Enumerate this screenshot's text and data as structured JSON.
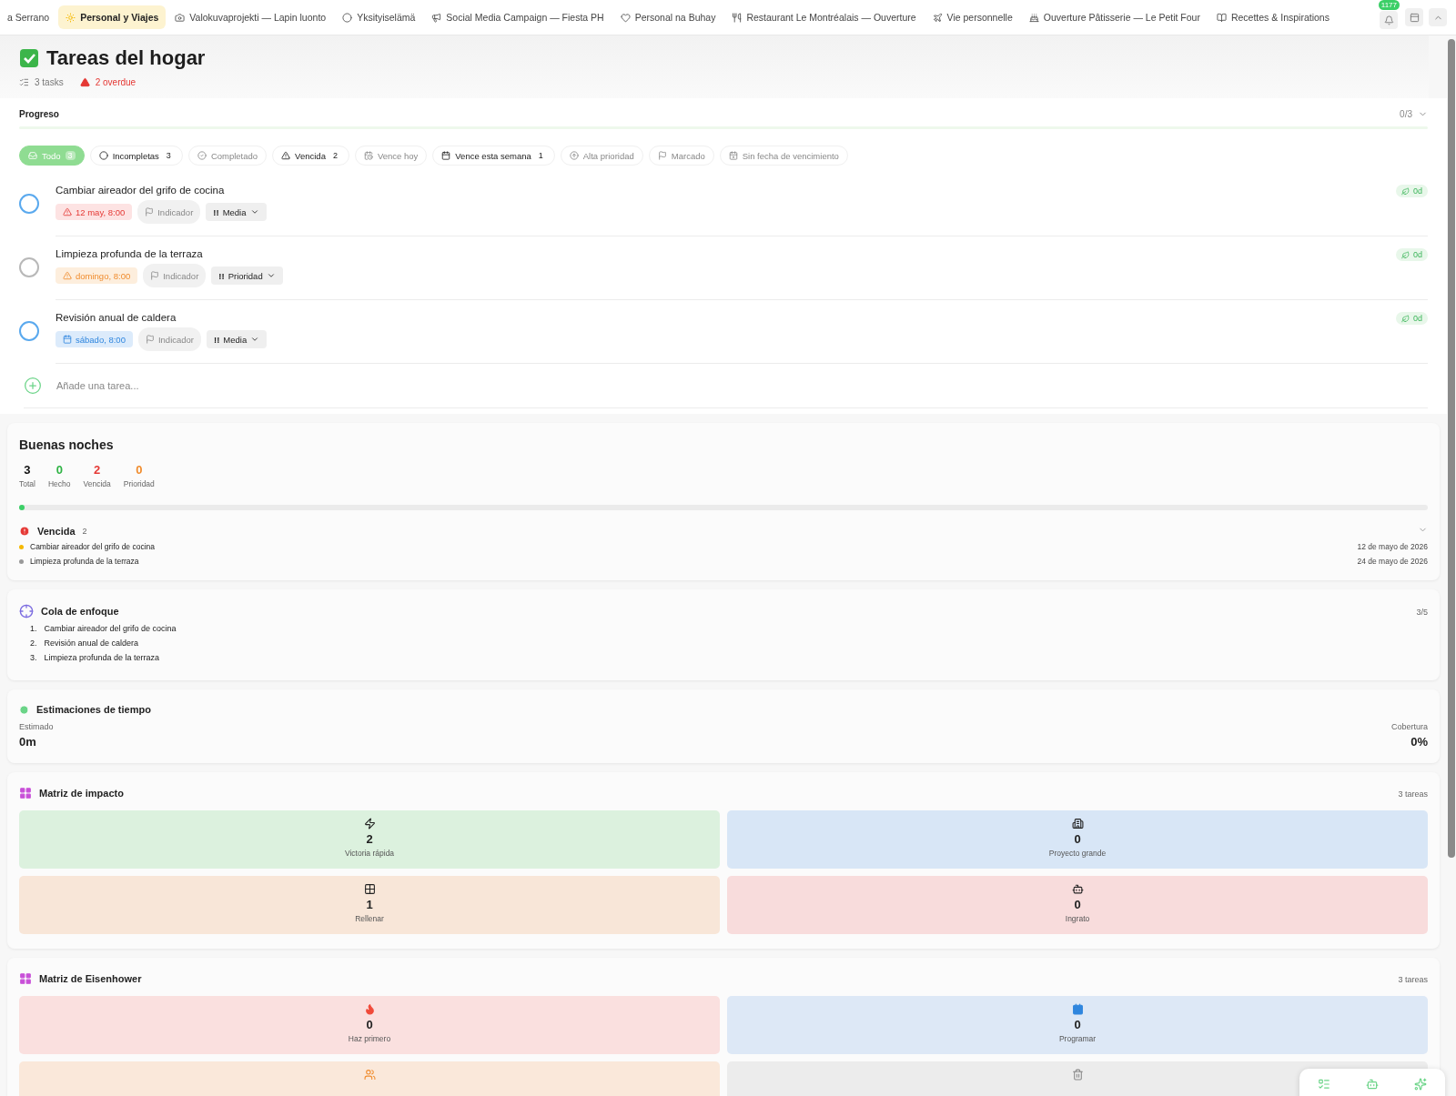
{
  "tabs": [
    {
      "label": "a Serrano",
      "selected": false
    },
    {
      "label": "Personal y Viajes",
      "selected": true
    },
    {
      "label": "Valokuvaprojekti — Lapin luonto",
      "selected": false
    },
    {
      "label": "Yksityiselämä",
      "selected": false
    },
    {
      "label": "Social Media Campaign — Fiesta PH",
      "selected": false
    },
    {
      "label": "Personal na Buhay",
      "selected": false
    },
    {
      "label": "Restaurant Le Montréalais — Ouverture",
      "selected": false
    },
    {
      "label": "Vie personnelle",
      "selected": false
    },
    {
      "label": "Ouverture Pâtisserie — Le Petit Four",
      "selected": false
    },
    {
      "label": "Recettes & Inspirations",
      "selected": false
    }
  ],
  "notifications": {
    "badge": "1177"
  },
  "header": {
    "title": "Tareas del hogar",
    "task_count": "3 tasks",
    "overdue": "2 overdue"
  },
  "progress": {
    "label": "Progreso",
    "count": "0/3",
    "level": 0
  },
  "filters": [
    {
      "label": "Todo",
      "count": "3",
      "selected": true,
      "disabled": false
    },
    {
      "label": "Incompletas",
      "count": "3",
      "selected": false,
      "disabled": false
    },
    {
      "label": "Completado",
      "selected": false,
      "disabled": true
    },
    {
      "label": "Vencida",
      "count": "2",
      "selected": false,
      "disabled": false
    },
    {
      "label": "Vence hoy",
      "selected": false,
      "disabled": true
    },
    {
      "label": "Vence esta semana",
      "count": "1",
      "selected": false,
      "disabled": false
    },
    {
      "label": "Alta prioridad",
      "selected": false,
      "disabled": true
    },
    {
      "label": "Marcado",
      "selected": false,
      "disabled": true
    },
    {
      "label": "Sin fecha de vencimiento",
      "selected": false,
      "disabled": true
    }
  ],
  "tasks": [
    {
      "title": "Cambiar aireador del grifo de cocina",
      "due": "12 may, 8:00",
      "kind": "overdue",
      "flag": "Indicador",
      "priority_mark": "!!",
      "priority": "Media",
      "color": "#5aa9ee",
      "age": "0d"
    },
    {
      "title": "Limpieza profunda de la terraza",
      "due": "domingo, 8:00",
      "kind": "soon",
      "flag": "Indicador",
      "priority_mark": "!!",
      "priority": "Prioridad",
      "color": "#b8b8b8",
      "age": "0d"
    },
    {
      "title": "Revisión anual de caldera",
      "due": "sábado, 8:00",
      "kind": "upcoming",
      "flag": "Indicador",
      "priority_mark": "!!",
      "priority": "Media",
      "color": "#5aa9ee",
      "age": "0d"
    }
  ],
  "add_task": {
    "placeholder": "Añade una tarea..."
  },
  "summary": {
    "title": "Buenas noches",
    "stats": [
      {
        "value": "3",
        "label": "Total",
        "color": "#111111"
      },
      {
        "value": "0",
        "label": "Hecho",
        "color": "#2fb344"
      },
      {
        "value": "2",
        "label": "Vencida",
        "color": "#e53935"
      },
      {
        "value": "0",
        "label": "Prioridad",
        "color": "#f08c2e"
      }
    ],
    "level": 0.004,
    "group": {
      "title": "Vencida",
      "count": "2",
      "expanded": true,
      "items": [
        {
          "title": "Cambiar aireador del grifo de cocina",
          "date": "12 de mayo de 2026",
          "color": "#f5b800"
        },
        {
          "title": "Limpieza profunda de la terraza",
          "date": "24 de mayo de 2026",
          "color": "#999999"
        }
      ]
    }
  },
  "focus": {
    "title": "Cola de enfoque",
    "count": "3/5",
    "items": [
      {
        "number": "1.",
        "title": "Cambiar aireador del grifo de cocina"
      },
      {
        "number": "2.",
        "title": "Revisión anual de caldera"
      },
      {
        "number": "3.",
        "title": "Limpieza profunda de la terraza"
      }
    ]
  },
  "estimates": {
    "title": "Estimaciones de tiempo",
    "estimated_label": "Estimado",
    "estimated": "0m",
    "coverage_label": "Cobertura",
    "coverage": "0%"
  },
  "impact": {
    "title": "Matriz de impacto",
    "count": "3 tareas",
    "cells": [
      {
        "value": "2",
        "label": "Victoria rápida",
        "color": "#dcf1de"
      },
      {
        "value": "0",
        "label": "Proyecto grande",
        "color": "#d8e6f6"
      },
      {
        "value": "1",
        "label": "Rellenar",
        "color": "#f8e6d8"
      },
      {
        "value": "0",
        "label": "Ingrato",
        "color": "#f8dcdc"
      }
    ]
  },
  "eisenhower": {
    "title": "Matriz de Eisenhower",
    "count": "3 tareas",
    "cells": [
      {
        "value": "0",
        "label": "Haz primero",
        "color": "#fae0df"
      },
      {
        "value": "0",
        "label": "Programar",
        "color": "#dde8f6"
      },
      {
        "color": "#fae8da"
      },
      {
        "color": "#ececec"
      }
    ]
  }
}
